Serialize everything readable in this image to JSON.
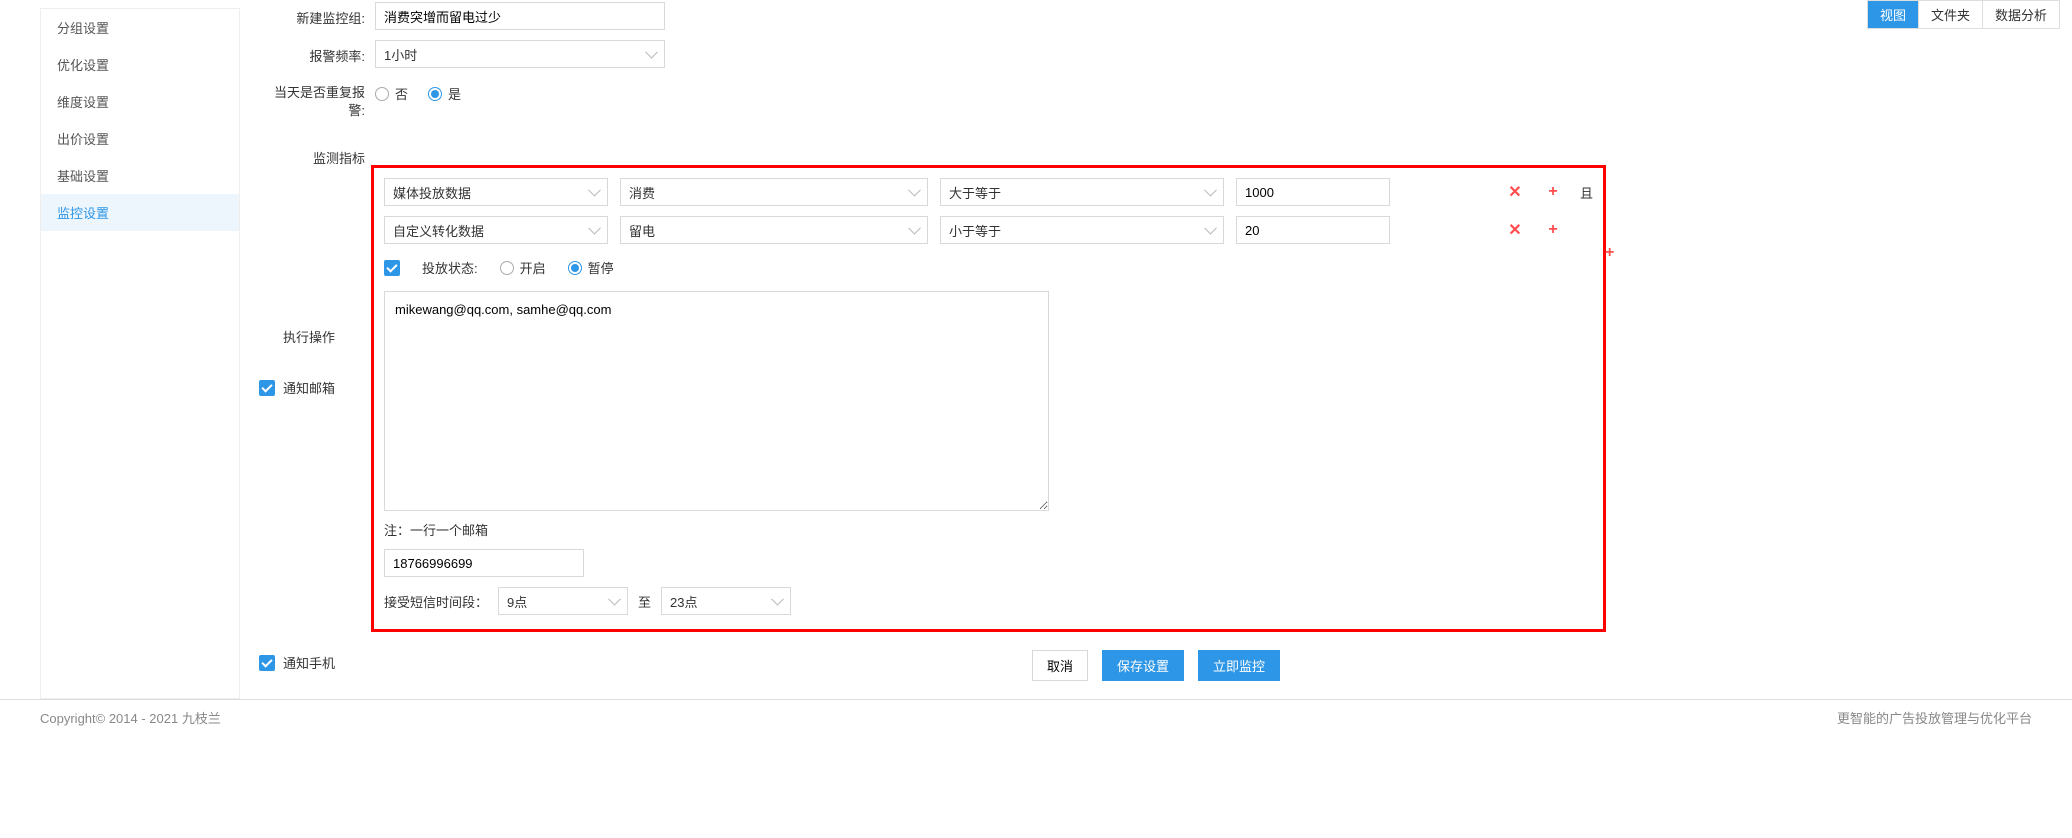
{
  "topTabs": {
    "view": "视图",
    "folder": "文件夹",
    "analysis": "数据分析",
    "active": 0
  },
  "sidebar": {
    "items": [
      {
        "label": "分组设置"
      },
      {
        "label": "优化设置"
      },
      {
        "label": "维度设置"
      },
      {
        "label": "出价设置"
      },
      {
        "label": "基础设置"
      },
      {
        "label": "监控设置"
      }
    ],
    "active": 5
  },
  "form": {
    "newGroup": {
      "label": "新建监控组:",
      "value": "消费突增而留电过少"
    },
    "alarmFreq": {
      "label": "报警频率:",
      "value": "1小时"
    },
    "repeatAlarm": {
      "label": "当天是否重复报警:",
      "no": "否",
      "yes": "是",
      "value": "yes"
    },
    "metrics": {
      "label": "监测指标",
      "rows": [
        {
          "source": "媒体投放数据",
          "field": "消费",
          "op": "大于等于",
          "value": "1000",
          "and": "且"
        },
        {
          "source": "自定义转化数据",
          "field": "留电",
          "op": "小于等于",
          "value": "20"
        }
      ]
    },
    "execAction": {
      "label": "执行操作",
      "statusLabel": "投放状态:",
      "open": "开启",
      "pause": "暂停",
      "checked": true,
      "value": "pause"
    },
    "notifyEmail": {
      "label": "通知邮箱",
      "value": "mikewang@qq.com, samhe@qq.com",
      "note": "注：一行一个邮箱",
      "checked": true
    },
    "notifyPhone": {
      "label": "通知手机",
      "value": "18766996699",
      "checked": true
    },
    "smsTime": {
      "label": "接受短信时间段：",
      "from": "9点",
      "toLabel": "至",
      "to": "23点"
    }
  },
  "actions": {
    "cancel": "取消",
    "save": "保存设置",
    "monitor": "立即监控"
  },
  "footer": {
    "copyright": "Copyright© 2014 - 2021 九枝兰",
    "slogan": "更智能的广告投放管理与优化平台"
  }
}
